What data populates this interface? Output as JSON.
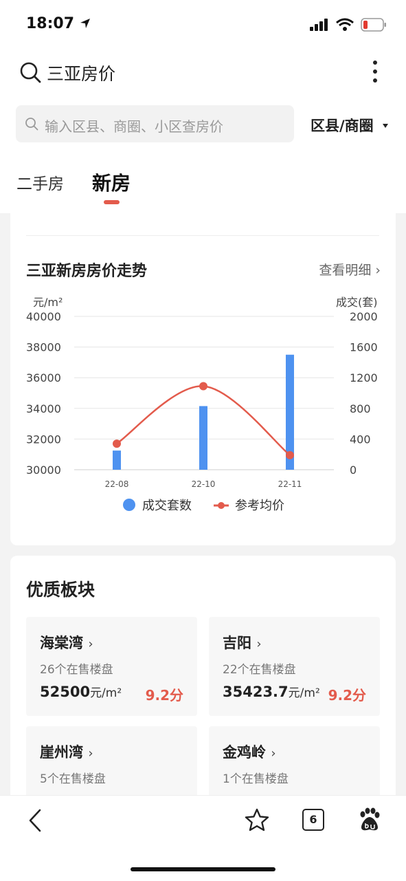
{
  "status_bar": {
    "time": "18:07"
  },
  "header": {
    "title": "三亚房价"
  },
  "search": {
    "placeholder": "输入区县、商圈、小区查房价",
    "district_label": "区县/商圈"
  },
  "tabs": [
    {
      "label": "二手房"
    },
    {
      "label": "新房"
    }
  ],
  "trend": {
    "title": "三亚新房房价走势",
    "detail_link": "查看明细 ›"
  },
  "chart_data": {
    "type": "bar",
    "categories": [
      "22-08",
      "22-10",
      "22-11"
    ],
    "left_axis": {
      "unit": "元/m²",
      "ticks": [
        "40000",
        "38000",
        "36000",
        "34000",
        "32000",
        "30000"
      ],
      "ylim": [
        30000,
        40000
      ]
    },
    "right_axis": {
      "unit": "成交(套)",
      "ticks": [
        "2000",
        "1600",
        "1200",
        "800",
        "400",
        "0"
      ],
      "ylim": [
        0,
        2000
      ]
    },
    "series": [
      {
        "name": "成交套数",
        "type": "bar",
        "axis": "right",
        "color": "#4e92f0",
        "values": [
          250,
          830,
          1500
        ]
      },
      {
        "name": "参考均价",
        "type": "line",
        "axis": "left",
        "color": "#e35b4c",
        "values": [
          31700,
          35450,
          30950
        ]
      }
    ],
    "grid": true,
    "legend": "bottom"
  },
  "quality": {
    "title": "优质板块",
    "areas": [
      {
        "name": "海棠湾",
        "count": "26个在售楼盘",
        "price": "52500",
        "unit": "元/m²",
        "score": "9.2分"
      },
      {
        "name": "吉阳",
        "count": "22个在售楼盘",
        "price": "35423.7",
        "unit": "元/m²",
        "score": "9.2分"
      },
      {
        "name": "崖州湾",
        "count": "5个在售楼盘"
      },
      {
        "name": "金鸡岭",
        "count": "1个在售楼盘"
      }
    ]
  },
  "bottom_bar": {
    "tab_count": "6"
  },
  "colors": {
    "accent": "#e35b4c",
    "bar": "#4e92f0"
  }
}
